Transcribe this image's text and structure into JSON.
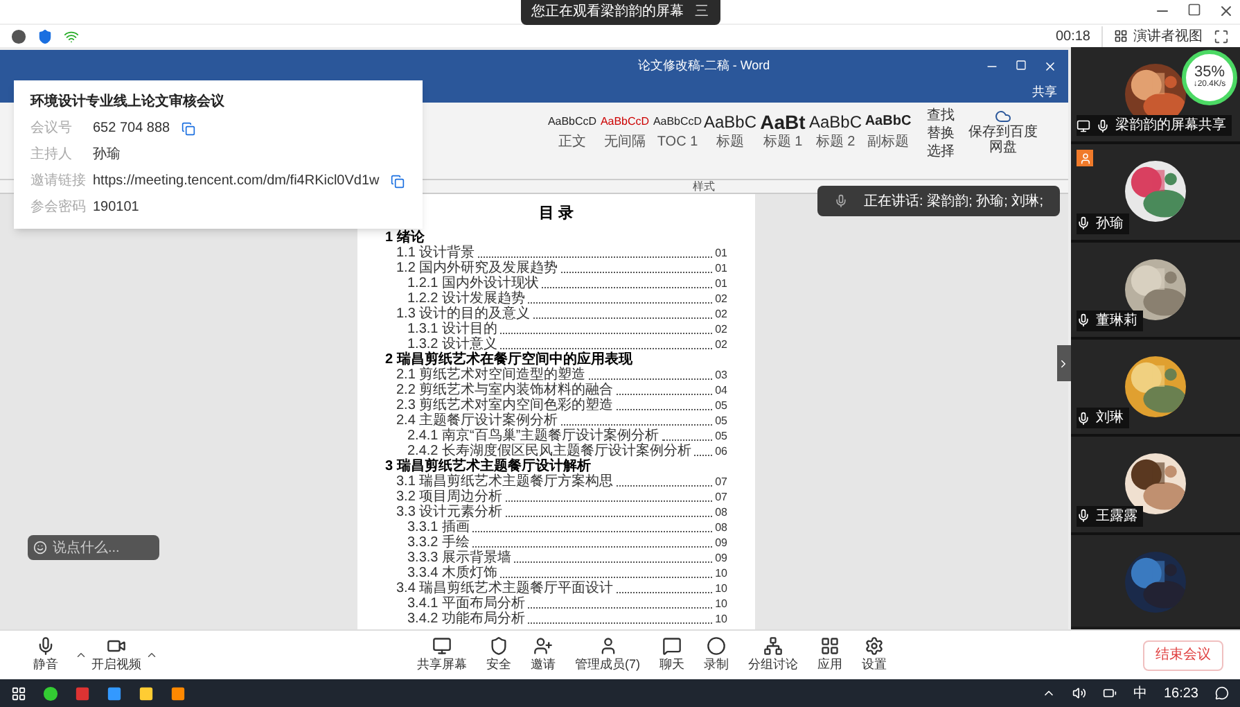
{
  "banner": {
    "text": "您正在观看梁韵韵的屏幕",
    "menu": "三"
  },
  "timer": "00:18",
  "view_button": "演讲者视图",
  "meeting_info": {
    "title": "环境设计专业线上论文审核会议",
    "rows": [
      {
        "label": "会议号",
        "value": "652 704 888",
        "copy": true
      },
      {
        "label": "主持人",
        "value": "孙瑜",
        "copy": false
      },
      {
        "label": "邀请链接",
        "value": "https://meeting.tencent.com/dm/fi4RKicl0Vd1w",
        "copy": true
      },
      {
        "label": "参会密码",
        "value": "190101",
        "copy": false
      }
    ]
  },
  "word": {
    "title": "论文修改稿-二稿 - Word",
    "share": "共享",
    "styles_group": "样式",
    "styles": [
      {
        "sample": "AaBbCcD",
        "label": "正文",
        "kind": "small",
        "selected": false
      },
      {
        "sample": "AaBbCcD",
        "label": "无间隔",
        "kind": "red",
        "selected": false
      },
      {
        "sample": "AaBbCcD",
        "label": "TOC 1",
        "kind": "small",
        "selected": false
      },
      {
        "sample": "AaBbC",
        "label": "标题",
        "kind": "big",
        "selected": false
      },
      {
        "sample": "AaBt",
        "label": "标题 1",
        "kind": "huge",
        "selected": false
      },
      {
        "sample": "AaBbC",
        "label": "标题 2",
        "kind": "big",
        "selected": false
      },
      {
        "sample": "AaBbC",
        "label": "副标题",
        "kind": "bold",
        "selected": false
      }
    ],
    "edit_items": [
      "查找",
      "替换",
      "选择"
    ],
    "save": "保存到百度网盘",
    "toc_title": "目 录",
    "toc": [
      {
        "text": "1 绪论",
        "children": [
          {
            "text": "1.1 设计背景",
            "page": "01"
          },
          {
            "text": "1.2 国内外研究及发展趋势",
            "page": "01",
            "children": [
              {
                "text": "1.2.1 国内外设计现状",
                "page": "01"
              },
              {
                "text": "1.2.2 设计发展趋势",
                "page": "02"
              }
            ]
          },
          {
            "text": "1.3 设计的目的及意义",
            "page": "02",
            "children": [
              {
                "text": "1.3.1 设计目的",
                "page": "02"
              },
              {
                "text": "1.3.2 设计意义",
                "page": "02"
              }
            ]
          }
        ]
      },
      {
        "text": "2 瑞昌剪纸艺术在餐厅空间中的应用表现",
        "children": [
          {
            "text": "2.1 剪纸艺术对空间造型的塑造",
            "page": "03"
          },
          {
            "text": "2.2 剪纸艺术与室内装饰材料的融合",
            "page": "04"
          },
          {
            "text": "2.3 剪纸艺术对室内空间色彩的塑造",
            "page": "05"
          },
          {
            "text": "2.4 主题餐厅设计案例分析",
            "page": "05",
            "children": [
              {
                "text": "2.4.1 南京“百鸟巢”主题餐厅设计案例分析",
                "page": "05"
              },
              {
                "text": "2.4.2 长寿湖度假区民风主题餐厅设计案例分析",
                "page": "06"
              }
            ]
          }
        ]
      },
      {
        "text": "3 瑞昌剪纸艺术主题餐厅设计解析",
        "children": [
          {
            "text": "3.1 瑞昌剪纸艺术主题餐厅方案构思",
            "page": "07"
          },
          {
            "text": "3.2 项目周边分析",
            "page": "07"
          },
          {
            "text": "3.3 设计元素分析",
            "page": "08",
            "children": [
              {
                "text": "3.3.1 插画",
                "page": "08"
              },
              {
                "text": "3.3.2 手绘",
                "page": "09"
              },
              {
                "text": "3.3.3 展示背景墙",
                "page": "09"
              },
              {
                "text": "3.3.4 木质灯饰",
                "page": "10"
              }
            ]
          },
          {
            "text": "3.4 瑞昌剪纸艺术主题餐厅平面设计",
            "page": "10",
            "children": [
              {
                "text": "3.4.1 平面布局分析",
                "page": "10"
              },
              {
                "text": "3.4.2 功能布局分析",
                "page": "10"
              }
            ]
          }
        ]
      }
    ]
  },
  "speaking": "正在讲话: 梁韵韵; 孙瑜; 刘琳;",
  "network": {
    "percent": "35%",
    "speed": "↓20.4K/s"
  },
  "participants": [
    {
      "name": "梁韵韵的屏幕共享",
      "sharing": true,
      "host": false
    },
    {
      "name": "孙瑜",
      "sharing": false,
      "host": true
    },
    {
      "name": "董琳莉",
      "sharing": false,
      "host": false
    },
    {
      "name": "刘琳",
      "sharing": false,
      "host": false
    },
    {
      "name": "王露露",
      "sharing": false,
      "host": false
    },
    {
      "kind": "unnamed"
    }
  ],
  "chat_placeholder": "说点什么...",
  "toolbar_left": [
    {
      "label": "静音",
      "kind": "mic"
    },
    {
      "label": "开启视频",
      "kind": "video"
    }
  ],
  "toolbar_center": [
    {
      "label": "共享屏幕",
      "kind": "share"
    },
    {
      "label": "安全",
      "kind": "shield"
    },
    {
      "label": "邀请",
      "kind": "invite"
    },
    {
      "label": "管理成员(7)",
      "kind": "members"
    },
    {
      "label": "聊天",
      "kind": "chat"
    },
    {
      "label": "录制",
      "kind": "record"
    },
    {
      "label": "分组讨论",
      "kind": "groups"
    },
    {
      "label": "应用",
      "kind": "apps"
    },
    {
      "label": "设置",
      "kind": "settings"
    }
  ],
  "end_button": "结束会议",
  "taskbar": {
    "ime": "中",
    "clock": "16:23"
  }
}
